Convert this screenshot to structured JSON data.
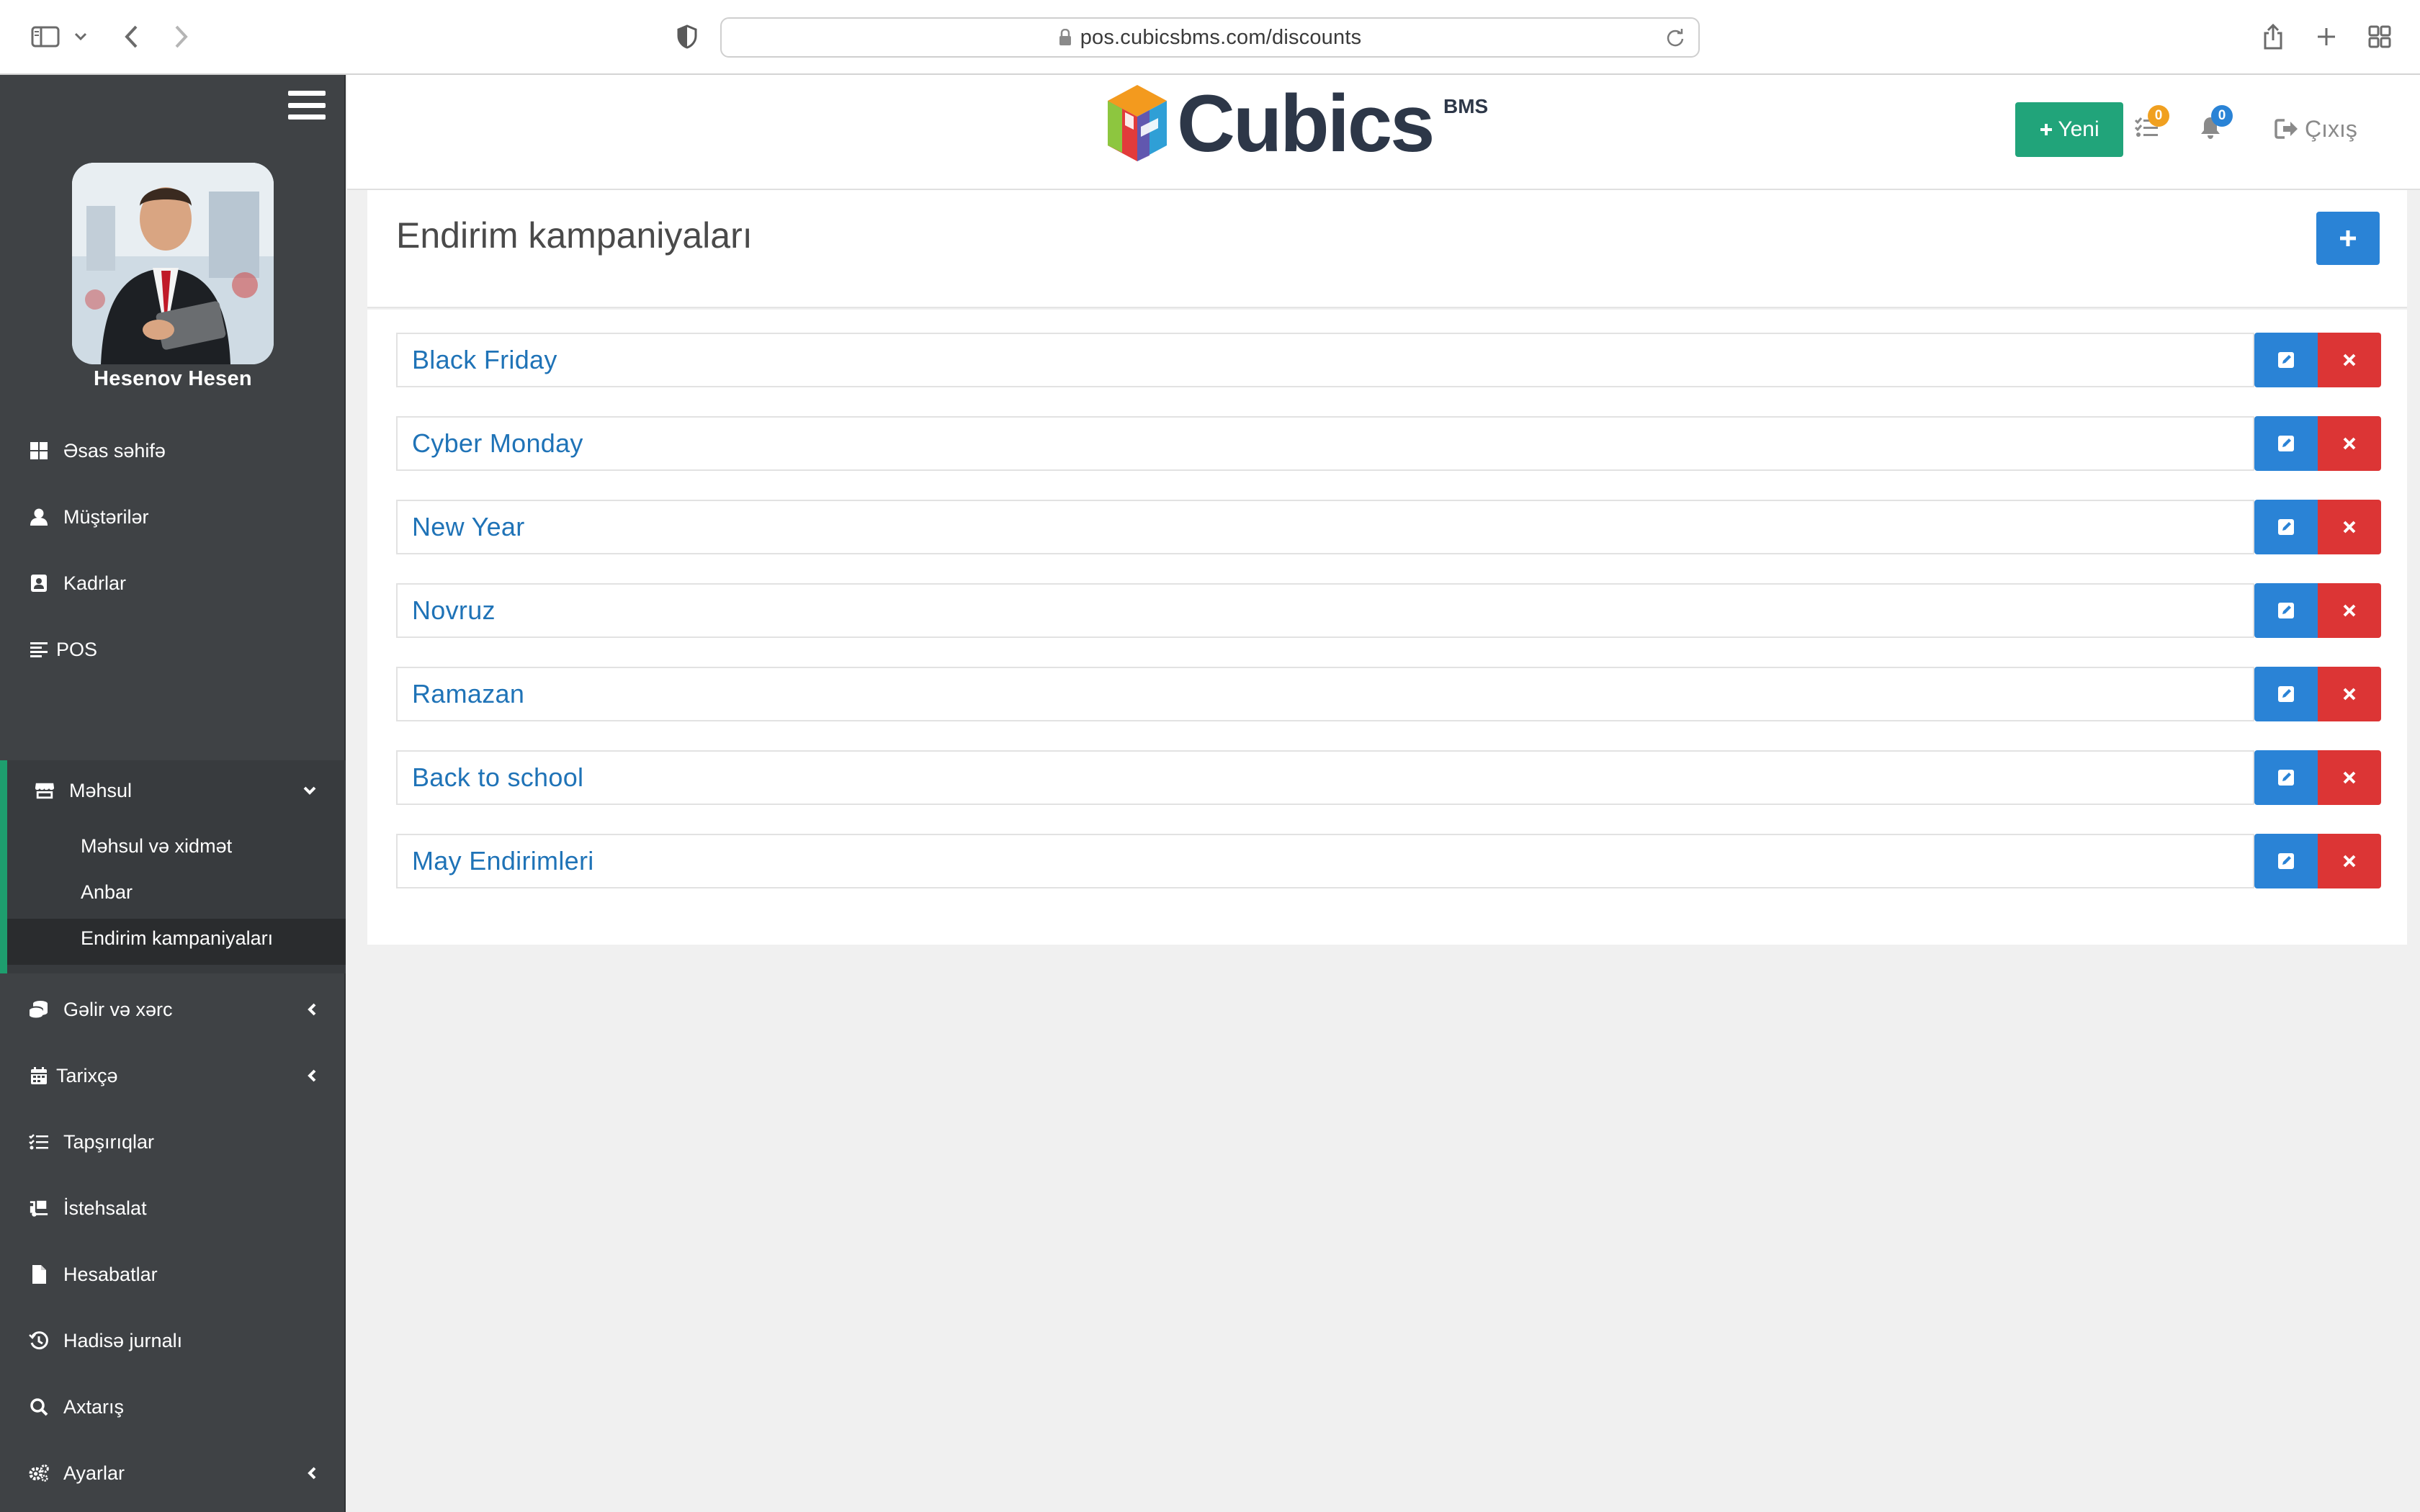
{
  "browser": {
    "url": "pos.cubicsbms.com/discounts"
  },
  "sidebar": {
    "user_name": "Hesenov Hesen",
    "items": [
      {
        "label": "Əsas səhifə",
        "icon": "dashboard-icon"
      },
      {
        "label": "Müştərilər",
        "icon": "user-icon"
      },
      {
        "label": "Kadrlar",
        "icon": "id-card-icon"
      },
      {
        "label": "POS",
        "icon": "align-left-icon"
      },
      {
        "label": "Məhsul",
        "icon": "store-icon",
        "expanded": true
      },
      {
        "label": "Gəlir və xərc",
        "icon": "coins-icon"
      },
      {
        "label": "Tarixçə",
        "icon": "calendar-icon"
      },
      {
        "label": "Tapşırıqlar",
        "icon": "tasks-icon"
      },
      {
        "label": "İstehsalat",
        "icon": "truck-loading-icon"
      },
      {
        "label": "Hesabatlar",
        "icon": "file-icon"
      },
      {
        "label": "Hadisə jurnalı",
        "icon": "history-icon"
      },
      {
        "label": "Axtarış",
        "icon": "search-icon"
      },
      {
        "label": "Ayarlar",
        "icon": "cogs-icon"
      }
    ],
    "submenu": [
      {
        "label": "Məhsul və xidmət"
      },
      {
        "label": "Anbar"
      },
      {
        "label": "Endirim kampaniyaları",
        "active": true
      }
    ]
  },
  "header": {
    "logo_text": "Cubics",
    "logo_sup": "BMS",
    "new_button": "Yeni",
    "tasks_badge": "0",
    "notifications_badge": "0",
    "logout": "Çıxış"
  },
  "page": {
    "title": "Endirim kampaniyaları",
    "campaigns": [
      "Black Friday",
      "Cyber Monday",
      "New Year",
      "Novruz",
      "Ramazan",
      "Back to school",
      "May Endirimleri"
    ]
  },
  "colors": {
    "sidebar_bg": "#3f4245",
    "accent_green": "#21a47a",
    "primary_blue": "#2a83d6",
    "danger_red": "#dc3535",
    "link_blue": "#1f73b7",
    "badge_orange": "#f0a020",
    "badge_blue": "#2a83d6"
  }
}
